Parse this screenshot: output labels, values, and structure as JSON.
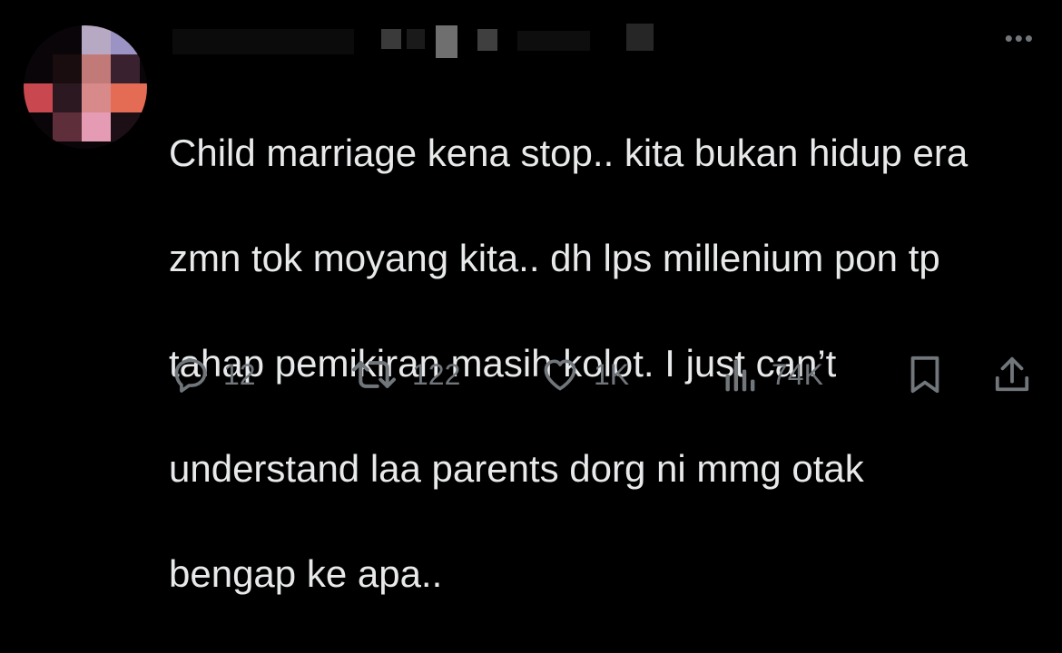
{
  "tweet": {
    "more_label": "•••",
    "text": "Child marriage kena stop.. kita bukan hidup era zmn tok moyang kita.. dh lps millenium pon tp tahap pemikiran masih kolot. I just can’t understand laa parents dorg ni mmg otak bengap ke apa..",
    "text_lines": [
      "Child marriage kena stop.. kita bukan hidup era",
      "zmn tok moyang kita.. dh lps millenium pon tp",
      "tahap pemikiran masih kolot. I just can’t",
      "understand laa parents dorg ni mmg otak",
      "bengap ke apa.."
    ]
  },
  "actions": {
    "reply": {
      "icon": "reply-icon",
      "count": "12"
    },
    "retweet": {
      "icon": "retweet-icon",
      "count": "122"
    },
    "like": {
      "icon": "heart-icon",
      "count": "1K"
    },
    "views": {
      "icon": "views-icon",
      "count": "74K"
    },
    "bookmark": {
      "icon": "bookmark-icon"
    },
    "share": {
      "icon": "share-icon"
    }
  },
  "colors": {
    "background": "#000000",
    "text": "#e7e9ea",
    "muted": "#71767b"
  }
}
